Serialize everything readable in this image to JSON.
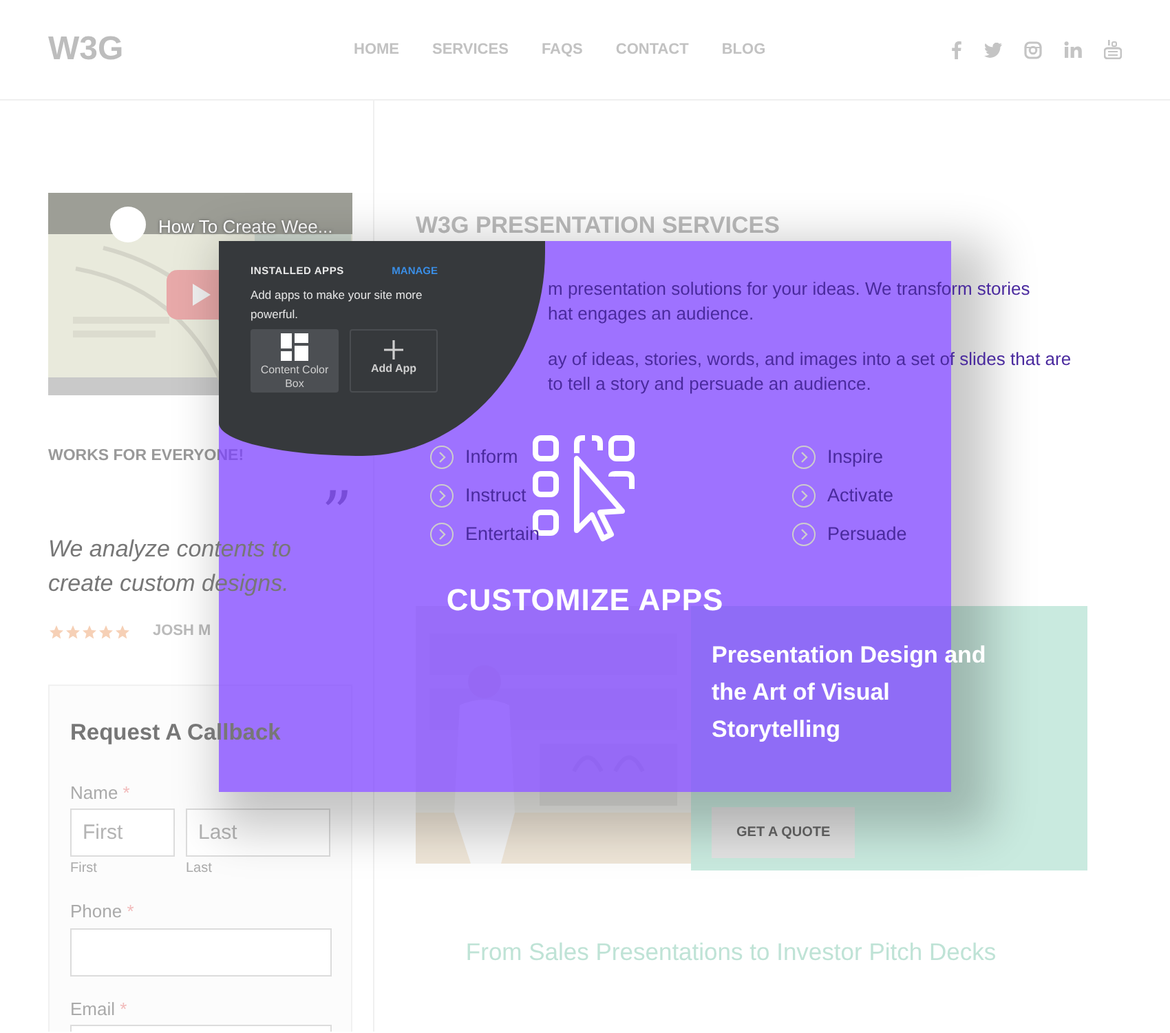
{
  "header": {
    "logo": "W3G",
    "nav": [
      {
        "label": "HOME"
      },
      {
        "label": "SERVICES"
      },
      {
        "label": "FAQS"
      },
      {
        "label": "CONTACT"
      },
      {
        "label": "BLOG"
      }
    ]
  },
  "video": {
    "title": "How To Create Wee..."
  },
  "testimonial": {
    "heading": "WORKS FOR EVERYONE!",
    "quote_mark": "”",
    "quote": "We analyze contents to create custom designs.",
    "stars": 5,
    "author": "JOSH M"
  },
  "form": {
    "title": "Request A Callback",
    "fields": [
      {
        "kind": "name",
        "label": "Name",
        "required_mark": "*",
        "parts": [
          {
            "placeholder": "First",
            "caption": "First"
          },
          {
            "placeholder": "Last",
            "caption": "Last"
          }
        ]
      },
      {
        "kind": "text",
        "label": "Phone",
        "required_mark": "*"
      },
      {
        "kind": "text",
        "label": "Email",
        "required_mark": "*"
      }
    ]
  },
  "services": {
    "heading": "W3G PRESENTATION SERVICES",
    "paragraphs": [
      [
        "m presentation solutions for your ideas. We transform stories",
        "hat engages an audience."
      ],
      [
        "ay of ideas, stories, words, and images into a set of slides that are",
        "to tell a story and persuade an audience."
      ]
    ],
    "features": [
      "Inform",
      "Inspire",
      "Instruct",
      "Activate",
      "Entertain",
      "Persuade"
    ]
  },
  "promo": {
    "title": "Presentation Design and the Art of Visual Storytelling",
    "button": "GET A QUOTE"
  },
  "tagline": "From Sales Presentations to Investor Pitch Decks",
  "overlay": {
    "panel": {
      "title": "INSTALLED APPS",
      "link": "MANAGE",
      "description": "Add apps to make your site more powerful.",
      "apps": [
        {
          "kind": "app",
          "label": "Content Color Box"
        },
        {
          "kind": "add",
          "label": "Add App"
        }
      ]
    },
    "caption": "CUSTOMIZE APPS"
  }
}
